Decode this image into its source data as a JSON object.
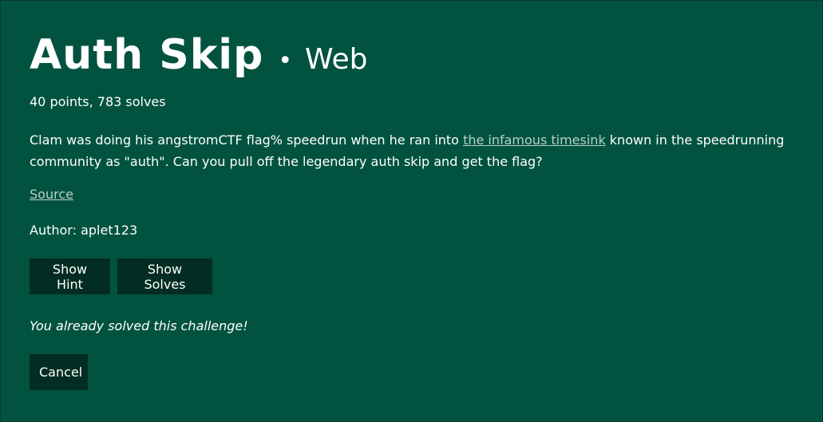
{
  "challenge": {
    "title": "Auth Skip",
    "separator": "•",
    "category": "Web",
    "meta": "40 points, 783 solves",
    "description": {
      "before_link": "Clam was doing his angstromCTF flag% speedrun when he ran into ",
      "link_text": "the infamous timesink",
      "after_link": " known in the speedrunning community as \"auth\". Can you pull off the legendary auth skip and get the flag?"
    },
    "source_link": "Source",
    "author": "Author: aplet123",
    "solved_message": "You already solved this challenge!"
  },
  "buttons": {
    "show_hint": "Show Hint",
    "show_solves": "Show Solves",
    "cancel": "Cancel"
  },
  "colors": {
    "background": "#01533f",
    "button": "#032d22",
    "link": "#b9cfc8",
    "text": "#ffffff"
  }
}
